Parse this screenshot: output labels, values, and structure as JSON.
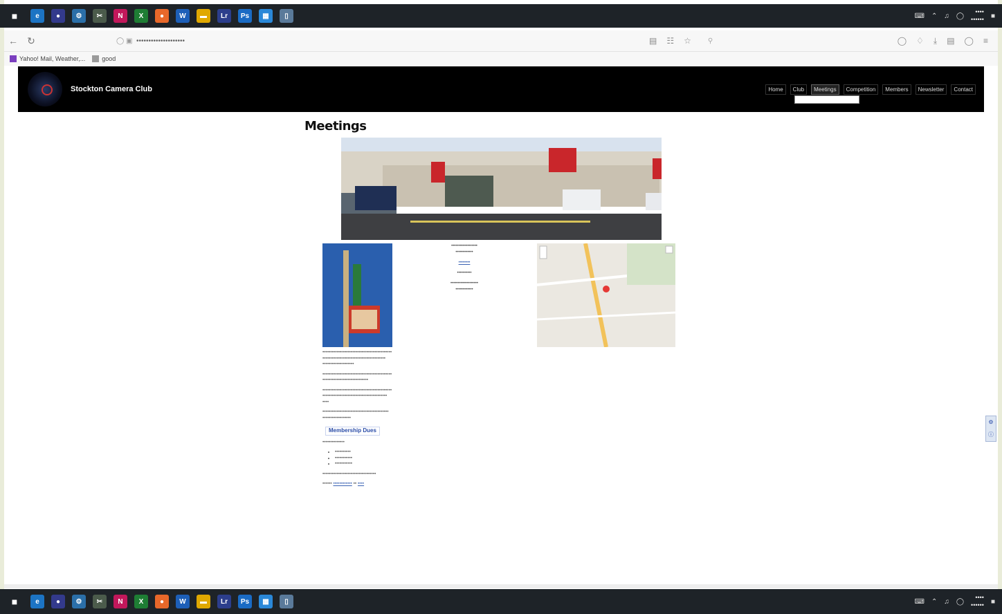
{
  "bookmarks": [
    {
      "label": "Yahoo! Mail, Weather,..."
    },
    {
      "label": "good"
    }
  ],
  "site": {
    "title": "Stockton Camera Club",
    "menu": [
      "Home",
      "Club",
      "Meetings",
      "Competition",
      "Members",
      "Newsletter",
      "Contact"
    ],
    "menu_active": "Meetings"
  },
  "page": {
    "title": "Meetings",
    "membership_button": "Membership Dues"
  },
  "colors": {
    "header_bg": "#000000",
    "taskbar_bg": "#1e2328",
    "link": "#3a62b3"
  }
}
